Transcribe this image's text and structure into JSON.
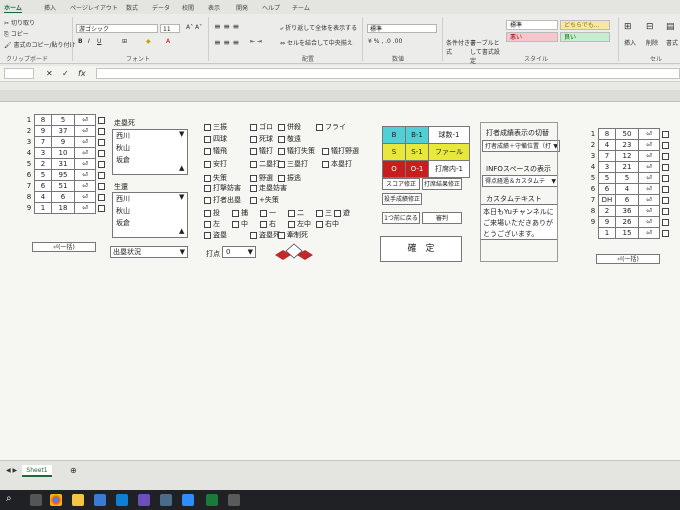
{
  "ribbon": {
    "tabs": [
      "ホーム",
      "挿入",
      "ページレイアウト",
      "数式",
      "データ",
      "校閲",
      "表示",
      "開発",
      "ヘルプ",
      "チーム"
    ],
    "clipboard": {
      "cut": "切り取り",
      "copy": "コピー",
      "painter": "書式のコピー/貼り付け",
      "label": "クリップボード"
    },
    "font": {
      "name": "游ゴシック",
      "size": "11",
      "label": "フォント"
    },
    "alignment": {
      "wrap": "折り返して全体を表示する",
      "merge": "セルを結合して中央揃え",
      "label": "配置"
    },
    "number": {
      "format": "標準",
      "label": "数値"
    },
    "styles": {
      "cond": "条件付き書式",
      "table": "テーブルとして書式設定",
      "standard": "標準",
      "dochira": "どちらでも...",
      "bad": "悪い",
      "good": "良い",
      "label": "スタイル"
    },
    "cells": {
      "insert": "挿入",
      "delete": "削除",
      "format": "書式",
      "label": "セル"
    }
  },
  "formula_bar": {
    "fx": "fx"
  },
  "scoreboard_left": {
    "rows": [
      {
        "n": "1",
        "a": "8",
        "b": "5"
      },
      {
        "n": "2",
        "a": "9",
        "b": "37"
      },
      {
        "n": "3",
        "a": "7",
        "b": "9"
      },
      {
        "n": "4",
        "a": "3",
        "b": "10"
      },
      {
        "n": "5",
        "a": "2",
        "b": "31"
      },
      {
        "n": "6",
        "a": "5",
        "b": "95"
      },
      {
        "n": "7",
        "a": "6",
        "b": "51"
      },
      {
        "n": "8",
        "a": "4",
        "b": "6"
      },
      {
        "n": "9",
        "a": "1",
        "b": "18"
      }
    ],
    "footer": "⏎(一括)"
  },
  "runners": {
    "title": "走塁死",
    "list1": [
      "西川",
      "秋山",
      "坂倉"
    ],
    "title2": "生還",
    "list2": [
      "西川",
      "秋山",
      "坂倉"
    ],
    "dropdown": "出塁状況"
  },
  "results": {
    "row1": [
      "三振",
      "ゴロ",
      "併殺",
      "フライ"
    ],
    "row2": [
      "四球",
      "死球",
      "敬遠"
    ],
    "row3": [
      "犠飛",
      "犠打",
      "犠打失策",
      "犠打野選"
    ],
    "row4": [
      "安打",
      "二塁打",
      "三塁打",
      "本塁打"
    ],
    "row5": [
      "失策",
      "野選",
      "振逃"
    ],
    "row6": [
      "打撃妨害",
      "走塁妨害"
    ],
    "row7": [
      "打者出塁",
      "+失策"
    ],
    "row8": [
      "投",
      "捕",
      "一",
      "二",
      "三",
      "遊"
    ],
    "row9": [
      "左",
      "中",
      "右",
      "左中",
      "右中"
    ],
    "row10": [
      "盗塁",
      "盗塁死",
      "牽制死"
    ],
    "rbi_label": "打点",
    "rbi_value": "0"
  },
  "count_panel": {
    "b": "B",
    "b1": "B-1",
    "ball": "球数-1",
    "s": "S",
    "s1": "S-1",
    "foul": "ファール",
    "o": "O",
    "o1": "O-1",
    "pa": "打席内-1",
    "score_fix": "スコア修正",
    "pa_fix": "打席結果修正",
    "pitcher_fix": "投手成績修正",
    "undo": "1つ前に戻る",
    "umpire": "審判",
    "confirm": "確　定"
  },
  "settings": {
    "title1": "打者成績表示の切替",
    "sel1": "打者成績＋守備位置（打",
    "title2": "INFOスペースの表示",
    "sel2": "得点経過＆カスタムテ",
    "title3": "カスタムテキスト",
    "custom_text": "本日もYuチャンネルにご来場いただきありがとうございます。"
  },
  "scoreboard_right": {
    "rows": [
      {
        "n": "1",
        "a": "8",
        "b": "50"
      },
      {
        "n": "2",
        "a": "4",
        "b": "23"
      },
      {
        "n": "3",
        "a": "7",
        "b": "12"
      },
      {
        "n": "4",
        "a": "3",
        "b": "21"
      },
      {
        "n": "5",
        "a": "5",
        "b": "5"
      },
      {
        "n": "6",
        "a": "6",
        "b": "4"
      },
      {
        "n": "7",
        "a": "DH",
        "b": "6"
      },
      {
        "n": "8",
        "a": "2",
        "b": "36"
      },
      {
        "n": "9",
        "a": "9",
        "b": "26"
      },
      {
        "n": "",
        "a": "1",
        "b": "15"
      }
    ],
    "footer": "⏎(一括)"
  },
  "sheet_tab": "Sheet1",
  "colors": {
    "accent": "#1a6b35",
    "b": "#4fd0d6",
    "s": "#e8e83a",
    "o": "#c81e1e",
    "diamond": "#c0282c"
  }
}
